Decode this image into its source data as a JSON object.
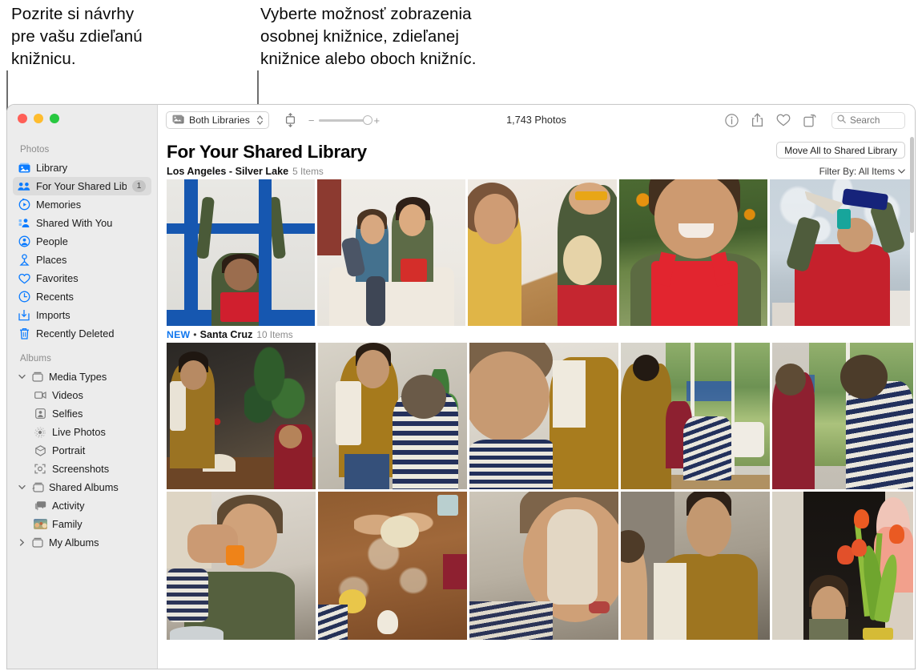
{
  "callouts": [
    {
      "id": "callout-1",
      "text": "Pozrite si návrhy\npre vašu zdieľanú\nknižnicu."
    },
    {
      "id": "callout-2",
      "text": "Vyberte možnosť zobrazenia\nosobnej knižnice, zdieľanej\nknižnice alebo oboch knižníc."
    }
  ],
  "window": {
    "traffic_lights": [
      "close",
      "minimize",
      "zoom"
    ],
    "colors": {
      "close": "#ff5f57",
      "minimize": "#febc2e",
      "zoom": "#28c840",
      "accent": "#0a7bff",
      "new_badge": "#1177ee"
    }
  },
  "sidebar": {
    "sections": [
      {
        "title": "Photos",
        "items": [
          {
            "label": "Library",
            "icon": "photos-library-icon",
            "selected": false
          },
          {
            "label": "For Your Shared Library",
            "icon": "shared-library-people-icon",
            "selected": true,
            "badge": "1"
          },
          {
            "label": "Memories",
            "icon": "memories-icon",
            "selected": false
          },
          {
            "label": "Shared With You",
            "icon": "shared-with-you-icon",
            "selected": false
          },
          {
            "label": "People",
            "icon": "people-icon",
            "selected": false
          },
          {
            "label": "Places",
            "icon": "places-pin-icon",
            "selected": false
          },
          {
            "label": "Favorites",
            "icon": "heart-icon",
            "selected": false
          },
          {
            "label": "Recents",
            "icon": "clock-icon",
            "selected": false
          },
          {
            "label": "Imports",
            "icon": "import-arrow-icon",
            "selected": false
          },
          {
            "label": "Recently Deleted",
            "icon": "trash-icon",
            "selected": false
          }
        ]
      },
      {
        "title": "Albums",
        "groups": [
          {
            "label": "Media Types",
            "icon": "album-box-icon",
            "expanded": true,
            "twisty": "chevron-down-icon",
            "children": [
              {
                "label": "Videos",
                "icon": "video-camera-icon"
              },
              {
                "label": "Selfies",
                "icon": "selfie-portrait-icon"
              },
              {
                "label": "Live Photos",
                "icon": "live-photo-icon"
              },
              {
                "label": "Portrait",
                "icon": "portrait-cube-icon"
              },
              {
                "label": "Screenshots",
                "icon": "screenshot-icon"
              }
            ]
          },
          {
            "label": "Shared Albums",
            "icon": "shared-album-box-icon",
            "expanded": true,
            "twisty": "chevron-down-icon",
            "children": [
              {
                "label": "Activity",
                "icon": "activity-bubbles-icon"
              },
              {
                "label": "Family",
                "icon": "family-album-thumbnail"
              }
            ]
          },
          {
            "label": "My Albums",
            "icon": "album-box-icon",
            "expanded": false,
            "twisty": "chevron-right-icon",
            "children": []
          }
        ]
      }
    ]
  },
  "toolbar": {
    "library_picker": {
      "label": "Both Libraries",
      "icon": "photos-stack-icon",
      "stepper": "up-down-stepper-icon"
    },
    "view_toggle_icon": "aspect-fit-icon",
    "zoom": {
      "minus": "−",
      "plus": "+",
      "value": 90
    },
    "photo_count": "1,743 Photos",
    "actions": [
      {
        "name": "info-icon",
        "glyph": "ⓘ"
      },
      {
        "name": "share-icon",
        "glyph": "share"
      },
      {
        "name": "favorite-heart-icon",
        "glyph": "heart"
      },
      {
        "name": "rotate-icon",
        "glyph": "rotate"
      }
    ],
    "search": {
      "placeholder": "Search",
      "value": "",
      "icon": "search-icon"
    }
  },
  "main": {
    "page_title": "For Your Shared Library",
    "move_all_button": "Move All to Shared Library",
    "filter": {
      "label": "Filter By: All Items",
      "chevron": "chevron-down-icon"
    },
    "sections": [
      {
        "new": false,
        "name": "Los Angeles - Silver Lake",
        "count": "5 Items",
        "photos": [
          {
            "id": "p1",
            "alt": "child with arms raised at a blue-framed window"
          },
          {
            "id": "p2",
            "alt": "two boys sitting on a bed with a red box"
          },
          {
            "id": "p3",
            "alt": "girl and boy with yellow glasses playing ukulele"
          },
          {
            "id": "p4",
            "alt": "smiling boy in red overalls under orange tree"
          },
          {
            "id": "p5",
            "alt": "child blowing a megaphone horn against cloudy sky"
          }
        ]
      },
      {
        "new": true,
        "new_label": "NEW",
        "separator": "•",
        "name": "Santa Cruz",
        "count": "10 Items",
        "photos_row1": [
          {
            "id": "q1",
            "alt": "woman baking at a table with plants and tulips"
          },
          {
            "id": "q2",
            "alt": "woman in mustard blouse with boy in striped shirt"
          },
          {
            "id": "q3",
            "alt": "close-up of boy laughing beside woman"
          },
          {
            "id": "q4",
            "alt": "family by a window working at a table"
          },
          {
            "id": "q5",
            "alt": "two boys leaning over a table by a window"
          }
        ],
        "photos_row2": [
          {
            "id": "r1",
            "alt": "toddler being fed an orange slice"
          },
          {
            "id": "r2",
            "alt": "hands kneading dough on a floury wooden table"
          },
          {
            "id": "r3",
            "alt": "boy with floury hands on his face"
          },
          {
            "id": "r4",
            "alt": "smiling woman in mustard shirt with towel"
          },
          {
            "id": "r5",
            "alt": "boy and baby behind orange tulips"
          }
        ]
      }
    ]
  }
}
